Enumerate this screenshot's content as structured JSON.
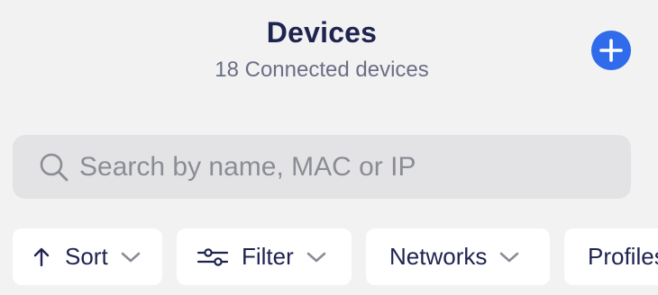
{
  "header": {
    "title": "Devices",
    "subtitle": "18 Connected devices"
  },
  "search": {
    "placeholder": "Search by name, MAC or IP"
  },
  "chips": {
    "sort": "Sort",
    "filter": "Filter",
    "networks": "Networks",
    "profiles": "Profiles"
  },
  "colors": {
    "accent": "#2f6bea",
    "title": "#1e2350",
    "background": "#f2f2f2"
  }
}
